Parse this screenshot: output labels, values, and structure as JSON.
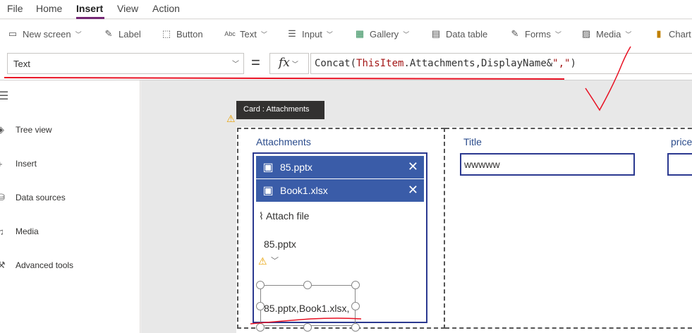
{
  "menu": {
    "file": "File",
    "home": "Home",
    "insert": "Insert",
    "view": "View",
    "action": "Action"
  },
  "ribbon": {
    "new_screen": "New screen",
    "label": "Label",
    "button": "Button",
    "text": "Text",
    "input": "Input",
    "gallery": "Gallery",
    "data_table": "Data table",
    "forms": "Forms",
    "media": "Media",
    "charts": "Chart"
  },
  "formula_bar": {
    "property": "Text",
    "equals": "=",
    "fx": "fx",
    "formula_func": "Concat(",
    "formula_kw": "ThisItem",
    "formula_mid": ".Attachments,DisplayName&",
    "formula_str": "\",\"",
    "formula_end": ")"
  },
  "sidebar": {
    "items": [
      {
        "label": "Tree view"
      },
      {
        "label": "Insert"
      },
      {
        "label": "Data sources"
      },
      {
        "label": "Media"
      },
      {
        "label": "Advanced tools"
      }
    ]
  },
  "canvas": {
    "tooltip": "Card : Attachments",
    "attachments_label": "Attachments",
    "attachments": [
      {
        "name": "85.pptx"
      },
      {
        "name": "Book1.xlsx"
      }
    ],
    "attach_file": "Attach file",
    "dropdown_value": "85.pptx",
    "concat_value": "85.pptx,Book1.xlsx,",
    "title_label": "Title",
    "title_value": "wwwww",
    "price_label": "price"
  },
  "colors": {
    "accent": "#3a5ca8",
    "border": "#2b3990",
    "annotation": "#e81123",
    "brand": "#742774"
  }
}
